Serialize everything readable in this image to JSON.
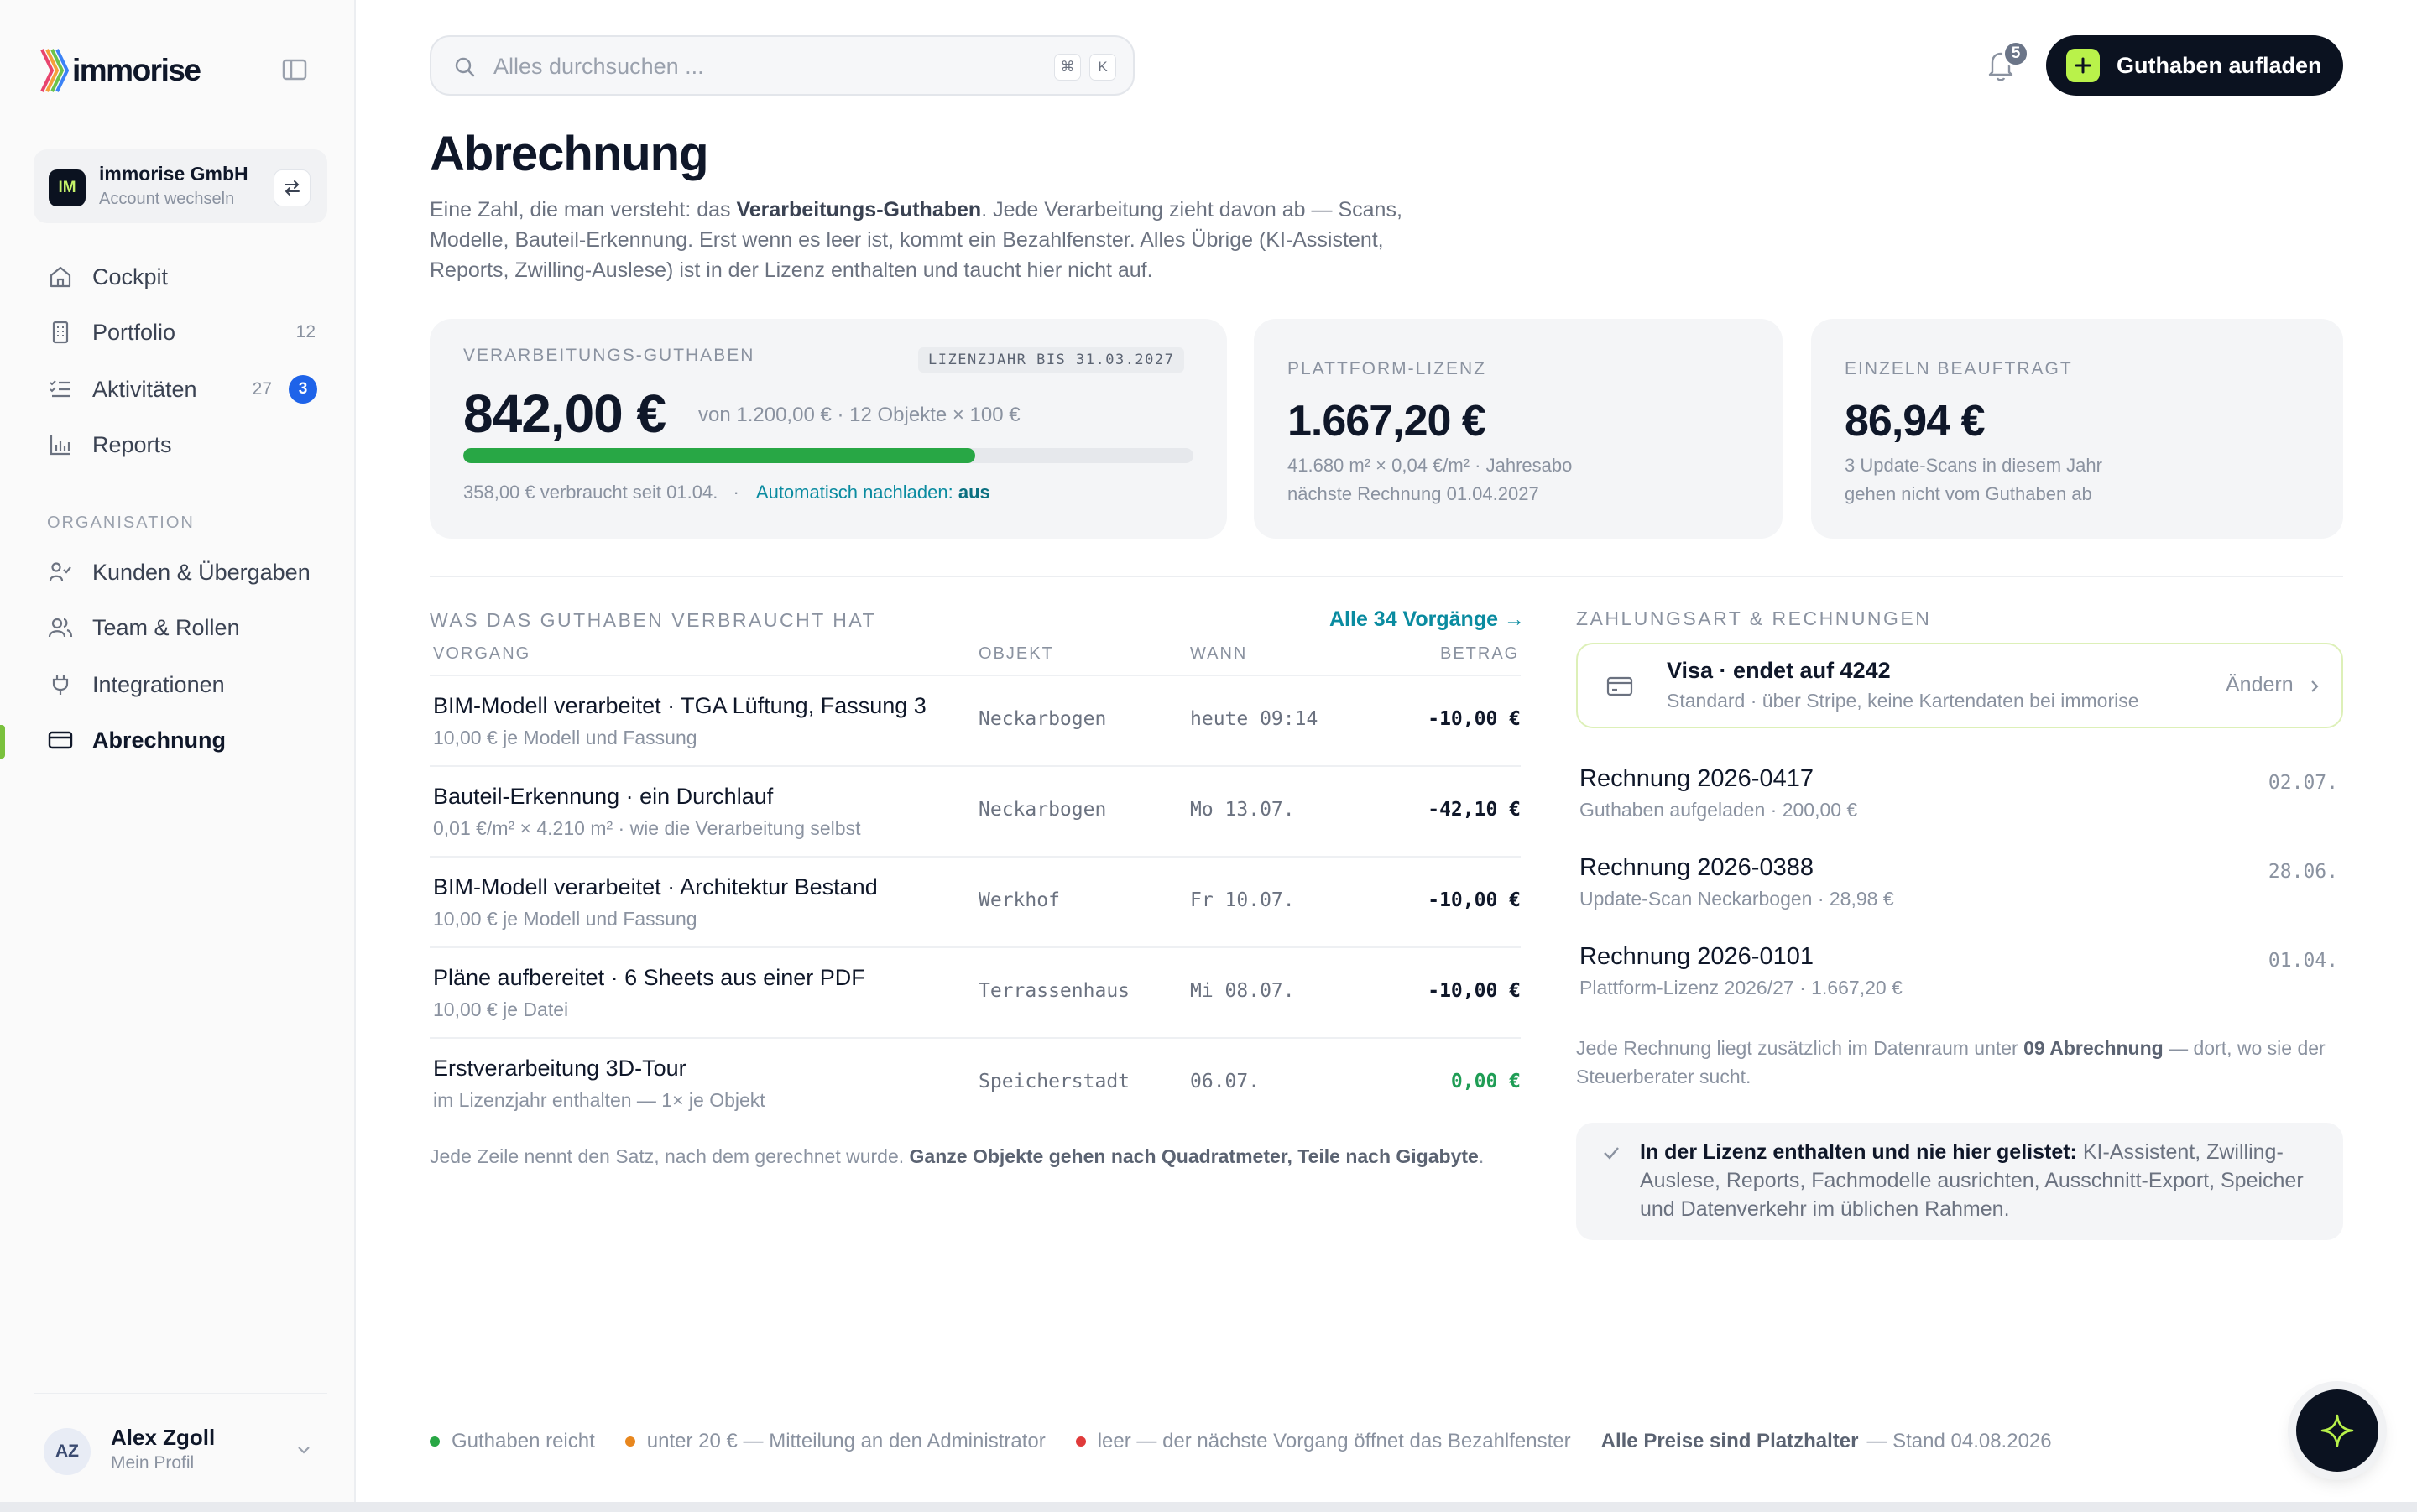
{
  "app": {
    "name": "immorise"
  },
  "account": {
    "initials": "IM",
    "name": "immorise GmbH",
    "switch_label": "Account wechseln"
  },
  "sidebar": {
    "items": [
      {
        "label": "Cockpit",
        "icon": "home-icon"
      },
      {
        "label": "Portfolio",
        "icon": "building-icon",
        "count": "12"
      },
      {
        "label": "Aktivitäten",
        "icon": "checklist-icon",
        "count": "27",
        "badge": "3"
      },
      {
        "label": "Reports",
        "icon": "bar-chart-icon"
      }
    ],
    "section_label": "ORGANISATION",
    "org_items": [
      {
        "label": "Kunden & Übergaben",
        "icon": "handshake-icon"
      },
      {
        "label": "Team & Rollen",
        "icon": "users-icon"
      },
      {
        "label": "Integrationen",
        "icon": "plug-icon"
      },
      {
        "label": "Abrechnung",
        "icon": "credit-card-icon",
        "active": true
      }
    ]
  },
  "profile": {
    "initials": "AZ",
    "name": "Alex Zgoll",
    "sub": "Mein Profil"
  },
  "search": {
    "placeholder": "Alles durchsuchen ...",
    "kbd1": "⌘",
    "kbd2": "K"
  },
  "notifications": {
    "count": "5"
  },
  "topup_button": {
    "label": "Guthaben aufladen"
  },
  "page": {
    "title": "Abrechnung",
    "intro_1": "Eine Zahl, die man versteht: das ",
    "intro_bold": "Verarbeitungs-Guthaben",
    "intro_2": ". Jede Verarbeitung zieht davon ab — Scans, Modelle, Bauteil-Erkennung. Erst wenn es leer ist, kommt ein Bezahlfenster. Alles Übrige (KI-Assistent, Reports, Zwilling-Auslese) ist in der Lizenz enthalten und taucht hier nicht auf."
  },
  "cards": {
    "credit": {
      "label": "VERARBEITUNGS-GUTHABEN",
      "chip": "LIZENZJAHR BIS 31.03.2027",
      "amount": "842,00 €",
      "of": "von 1.200,00 € · 12 Objekte × 100 €",
      "progress_fraction": 0.7017,
      "consumed": "358,00 € verbraucht seit 01.04.",
      "separator": "·",
      "auto_label": "Automatisch nachladen: ",
      "auto_value": "aus"
    },
    "license": {
      "label": "PLATTFORM-LIZENZ",
      "amount": "1.667,20 €",
      "line1": "41.680 m² × 0,04 €/m² · Jahresabo",
      "line2": "nächste Rechnung 01.04.2027"
    },
    "single": {
      "label": "EINZELN BEAUFTRAGT",
      "amount": "86,94 €",
      "line1": "3 Update-Scans in diesem Jahr",
      "line2": "gehen nicht vom Guthaben ab"
    }
  },
  "usage": {
    "title": "WAS DAS GUTHABEN VERBRAUCHT HAT",
    "all_link": "Alle 34 Vorgänge →",
    "columns": [
      "VORGANG",
      "OBJEKT",
      "WANN",
      "BETRAG"
    ],
    "rows": [
      {
        "title": "BIM-Modell verarbeitet · TGA Lüftung, Fassung 3",
        "sub": "10,00 € je Modell und Fassung",
        "object": "Neckarbogen",
        "when": "heute 09:14",
        "amount": "-10,00 €"
      },
      {
        "title": "Bauteil-Erkennung · ein Durchlauf",
        "sub": "0,01 €/m² × 4.210 m² · wie die Verarbeitung selbst",
        "object": "Neckarbogen",
        "when": "Mo 13.07.",
        "amount": "-42,10 €"
      },
      {
        "title": "BIM-Modell verarbeitet · Architektur Bestand",
        "sub": "10,00 € je Modell und Fassung",
        "object": "Werkhof",
        "when": "Fr 10.07.",
        "amount": "-10,00 €"
      },
      {
        "title": "Pläne aufbereitet · 6 Sheets aus einer PDF",
        "sub": "10,00 € je Datei",
        "object": "Terrassenhaus",
        "when": "Mi 08.07.",
        "amount": "-10,00 €"
      },
      {
        "title": "Erstverarbeitung 3D-Tour",
        "sub": "im Lizenzjahr enthalten — 1× je Objekt",
        "object": "Speicherstadt",
        "when": "06.07.",
        "amount": "0,00 €"
      }
    ],
    "note_1": "Jede Zeile nennt den Satz, nach dem gerechnet wurde. ",
    "note_bold": "Ganze Objekte gehen nach Quadratmeter, Teile nach Gigabyte",
    "note_2": "."
  },
  "payment": {
    "title": "ZAHLUNGSART & RECHNUNGEN",
    "card_title": "Visa · endet auf 4242",
    "card_sub": "Standard · über Stripe, keine Kartendaten bei immorise",
    "change": "Ändern",
    "invoices": [
      {
        "title": "Rechnung 2026-0417",
        "sub": "Guthaben aufgeladen · 200,00 €",
        "date": "02.07."
      },
      {
        "title": "Rechnung 2026-0388",
        "sub": "Update-Scan Neckarbogen · 28,98 €",
        "date": "28.06."
      },
      {
        "title": "Rechnung 2026-0101",
        "sub": "Plattform-Lizenz 2026/27 · 1.667,20 €",
        "date": "01.04."
      }
    ],
    "data_note_1": "Jede Rechnung liegt zusätzlich im Datenraum unter ",
    "data_note_bold": "09 Abrechnung",
    "data_note_2": " — dort, wo sie der Steuerberater sucht.",
    "license_bold": "In der Lizenz enthalten und nie hier gelistet: ",
    "license_text": "KI-Assistent, Zwilling-Auslese, Reports, Fachmodelle ausrichten, Ausschnitt-Export, Speicher und Datenverkehr im üblichen Rahmen."
  },
  "legend": {
    "items": [
      {
        "label": "Guthaben reicht",
        "color": "#28a745"
      },
      {
        "label": "unter 20 € — Mitteilung an den Administrator",
        "color": "#e8871e"
      },
      {
        "label": "leer — der nächste Vorgang öffnet das Bezahlfenster",
        "color": "#e03a3a"
      }
    ],
    "prices_bold": "Alle Preise sind Platzhalter",
    "prices_text": "— Stand 04.08.2026"
  },
  "assistant": {
    "icon": "sparkle-icon"
  }
}
